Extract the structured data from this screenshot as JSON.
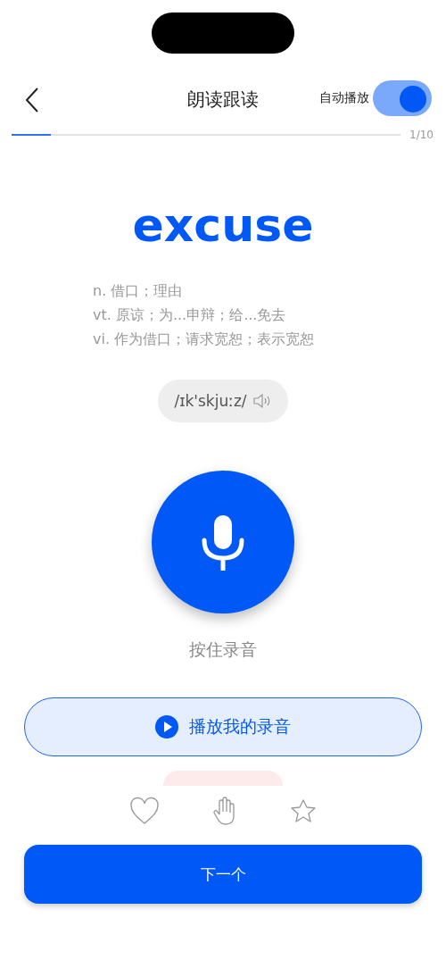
{
  "header": {
    "title": "朗读跟读",
    "auto_play": {
      "label": "自动播放",
      "on": true
    }
  },
  "progress": {
    "level": 0.1,
    "counter": "1/10"
  },
  "word": "excuse",
  "definitions": [
    "n. 借口；理由",
    "vt. 原谅；为...申辩；给...免去",
    "vi. 作为借口；请求宽恕；表示宽恕"
  ],
  "phonetic": "/ɪk'skjuːz/",
  "record_hint": "按住录音",
  "play_button": "播放我的录音",
  "next_button": "下一个"
}
